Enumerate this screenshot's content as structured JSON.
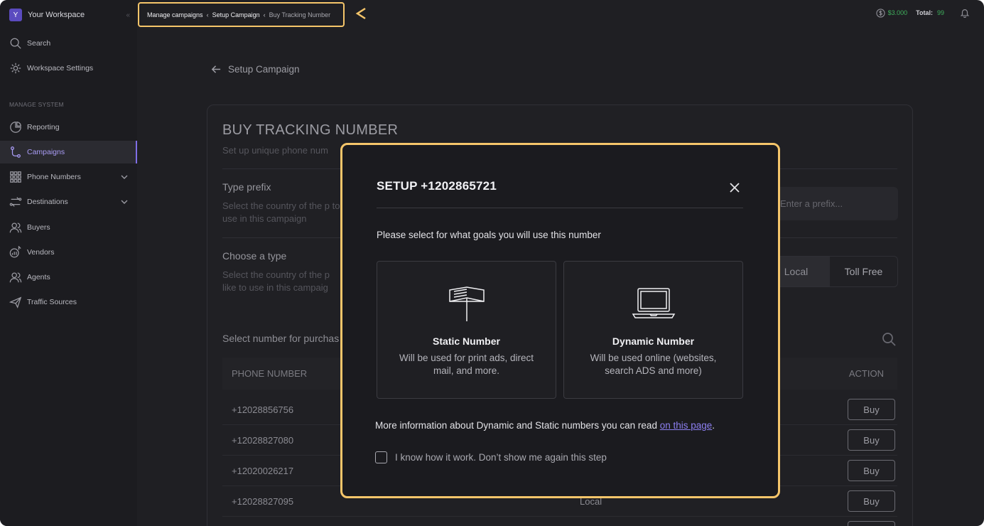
{
  "workspace": {
    "initial": "Y",
    "name": "Your Workspace",
    "collapse": "«"
  },
  "sidebar": {
    "top_items": [
      {
        "label": "Search",
        "icon": "search-icon"
      },
      {
        "label": "Workspace Settings",
        "icon": "gear-icon"
      }
    ],
    "section_label": "MANAGE SYSTEM",
    "items": [
      {
        "label": "Reporting",
        "icon": "pie-chart-icon"
      },
      {
        "label": "Campaigns",
        "icon": "route-icon",
        "active": true
      },
      {
        "label": "Phone Numbers",
        "icon": "grid-icon",
        "expandable": true
      },
      {
        "label": "Destinations",
        "icon": "arrows-icon",
        "expandable": true
      },
      {
        "label": "Buyers",
        "icon": "users-icon"
      },
      {
        "label": "Vendors",
        "icon": "vendor-chart-icon"
      },
      {
        "label": "Agents",
        "icon": "agents-icon"
      },
      {
        "label": "Traffic Sources",
        "icon": "send-icon"
      }
    ]
  },
  "breadcrumb": {
    "items": [
      "Manage campaigns",
      "Setup Campaign",
      "Buy Tracking Number"
    ],
    "separator": "‹"
  },
  "topbar": {
    "balance": "$3.000",
    "total_label": "Total:",
    "total_value": "99"
  },
  "main": {
    "back_label": "Setup Campaign",
    "title": "BUY TRACKING NUMBER",
    "subtitle": "Set up unique phone num",
    "prefix": {
      "label": "Type prefix",
      "desc": "Select the country of the p to use in this campaign",
      "placeholder": "Enter a prefix..."
    },
    "type": {
      "label": "Choose a type",
      "desc": "Select the country of the p like to use in this campaig",
      "options": [
        "Local",
        "Toll Free"
      ]
    },
    "select_label": "Select number for purchas",
    "table": {
      "headers": [
        "PHONE NUMBER",
        "ACTION"
      ],
      "rows": [
        {
          "number": "+12028856756",
          "type": "",
          "action": "Buy"
        },
        {
          "number": "+12028827080",
          "type": "",
          "action": "Buy"
        },
        {
          "number": "+12020026217",
          "type": "",
          "action": "Buy"
        },
        {
          "number": "+12028827095",
          "type": "Local",
          "action": "Buy"
        }
      ]
    }
  },
  "modal": {
    "title": "SETUP +1202865721",
    "question": "Please select for what goals you will use this number",
    "options": [
      {
        "title": "Static Number",
        "desc": "Will be used for print ads, direct mail, and more.",
        "icon": "billboard-icon"
      },
      {
        "title": "Dynamic Number",
        "desc": "Will be used online (websites, search ADS and more)",
        "icon": "laptop-icon"
      }
    ],
    "info_text": "More information about Dynamic and Static numbers you can read ",
    "info_link": "on this page",
    "info_end": ".",
    "checkbox_label": "I know how it work. Don’t show me again this step"
  },
  "colors": {
    "accent": "#7f6ee6",
    "highlight": "#f5c56a",
    "success": "#3fae5c",
    "link": "#8c7ff0"
  }
}
